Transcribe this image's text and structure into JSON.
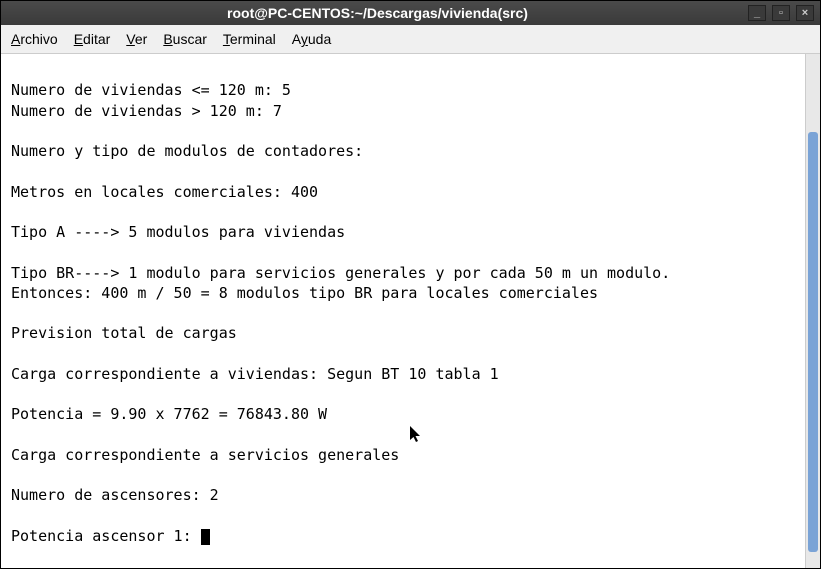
{
  "window": {
    "title": "root@PC-CENTOS:~/Descargas/vivienda(src)"
  },
  "menu": {
    "archivo": "Archivo",
    "editar": "Editar",
    "ver": "Ver",
    "buscar": "Buscar",
    "terminal": "Terminal",
    "ayuda": "Ayuda"
  },
  "terminal": {
    "lines": [
      "",
      "Numero de viviendas <= 120 m: 5",
      "Numero de viviendas > 120 m: 7",
      "",
      "Numero y tipo de modulos de contadores:",
      "",
      "Metros en locales comerciales: 400",
      "",
      "Tipo A ----> 5 modulos para viviendas",
      "",
      "Tipo BR----> 1 modulo para servicios generales y por cada 50 m un modulo.",
      "Entonces: 400 m / 50 = 8 modulos tipo BR para locales comerciales",
      "",
      "Prevision total de cargas",
      "",
      "Carga correspondiente a viviendas: Segun BT 10 tabla 1",
      "",
      "Potencia = 9.90 x 7762 = 76843.80 W",
      "",
      "Carga correspondiente a servicios generales",
      "",
      "Numero de ascensores: 2",
      ""
    ],
    "prompt_line": "Potencia ascensor 1: "
  },
  "controls": {
    "minimize": "_",
    "maximize": "▫",
    "close": "×"
  }
}
